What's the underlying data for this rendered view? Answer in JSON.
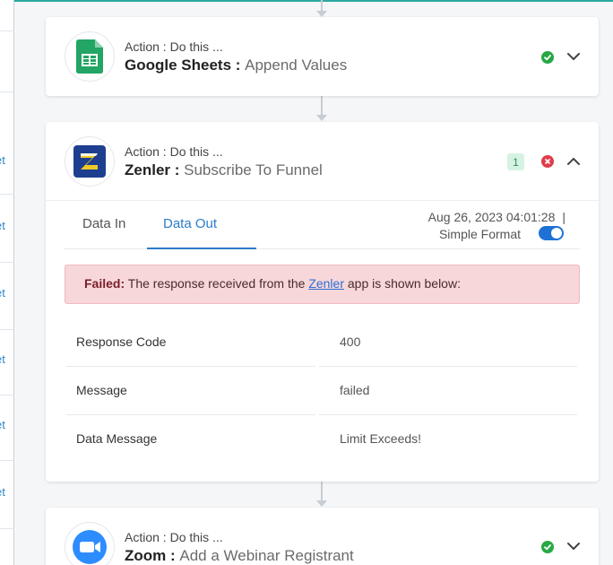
{
  "left_panel": {
    "fragments": [
      "et",
      "et",
      "et",
      "et",
      "et",
      "et"
    ]
  },
  "steps": [
    {
      "action_label": "Action : Do this ...",
      "app": "Google Sheets",
      "separator": " : ",
      "event": "Append Values",
      "icon": "google-sheets-icon",
      "status": "success"
    },
    {
      "action_label": "Action : Do this ...",
      "app": "Zenler",
      "separator": " : ",
      "event": "Subscribe To Funnel",
      "icon": "zenler-icon",
      "status": "error",
      "badge": "1",
      "tabs": [
        {
          "label": "Data In",
          "active": false
        },
        {
          "label": "Data Out",
          "active": true
        }
      ],
      "timestamp": "Aug 26, 2023 04:01:28",
      "timestamp_sep": "|",
      "format_label": "Simple Format",
      "format_enabled": true,
      "alert": {
        "prefix": "Failed:",
        "text_before": " The response received from the ",
        "link": "Zenler",
        "text_after": " app is shown below:"
      },
      "response": [
        {
          "key": "Response Code",
          "value": "400"
        },
        {
          "key": "Message",
          "value": "failed"
        },
        {
          "key": "Data Message",
          "value": "Limit Exceeds!"
        }
      ]
    },
    {
      "action_label": "Action : Do this ...",
      "app": "Zoom",
      "separator": " : ",
      "event": "Add a Webinar Registrant",
      "icon": "zoom-icon",
      "status": "success"
    }
  ],
  "colors": {
    "accent": "#2b7cc9",
    "success": "#27a844",
    "error": "#e03d4a",
    "alert_bg": "#f8d7da",
    "toggle": "#1e72d6"
  }
}
